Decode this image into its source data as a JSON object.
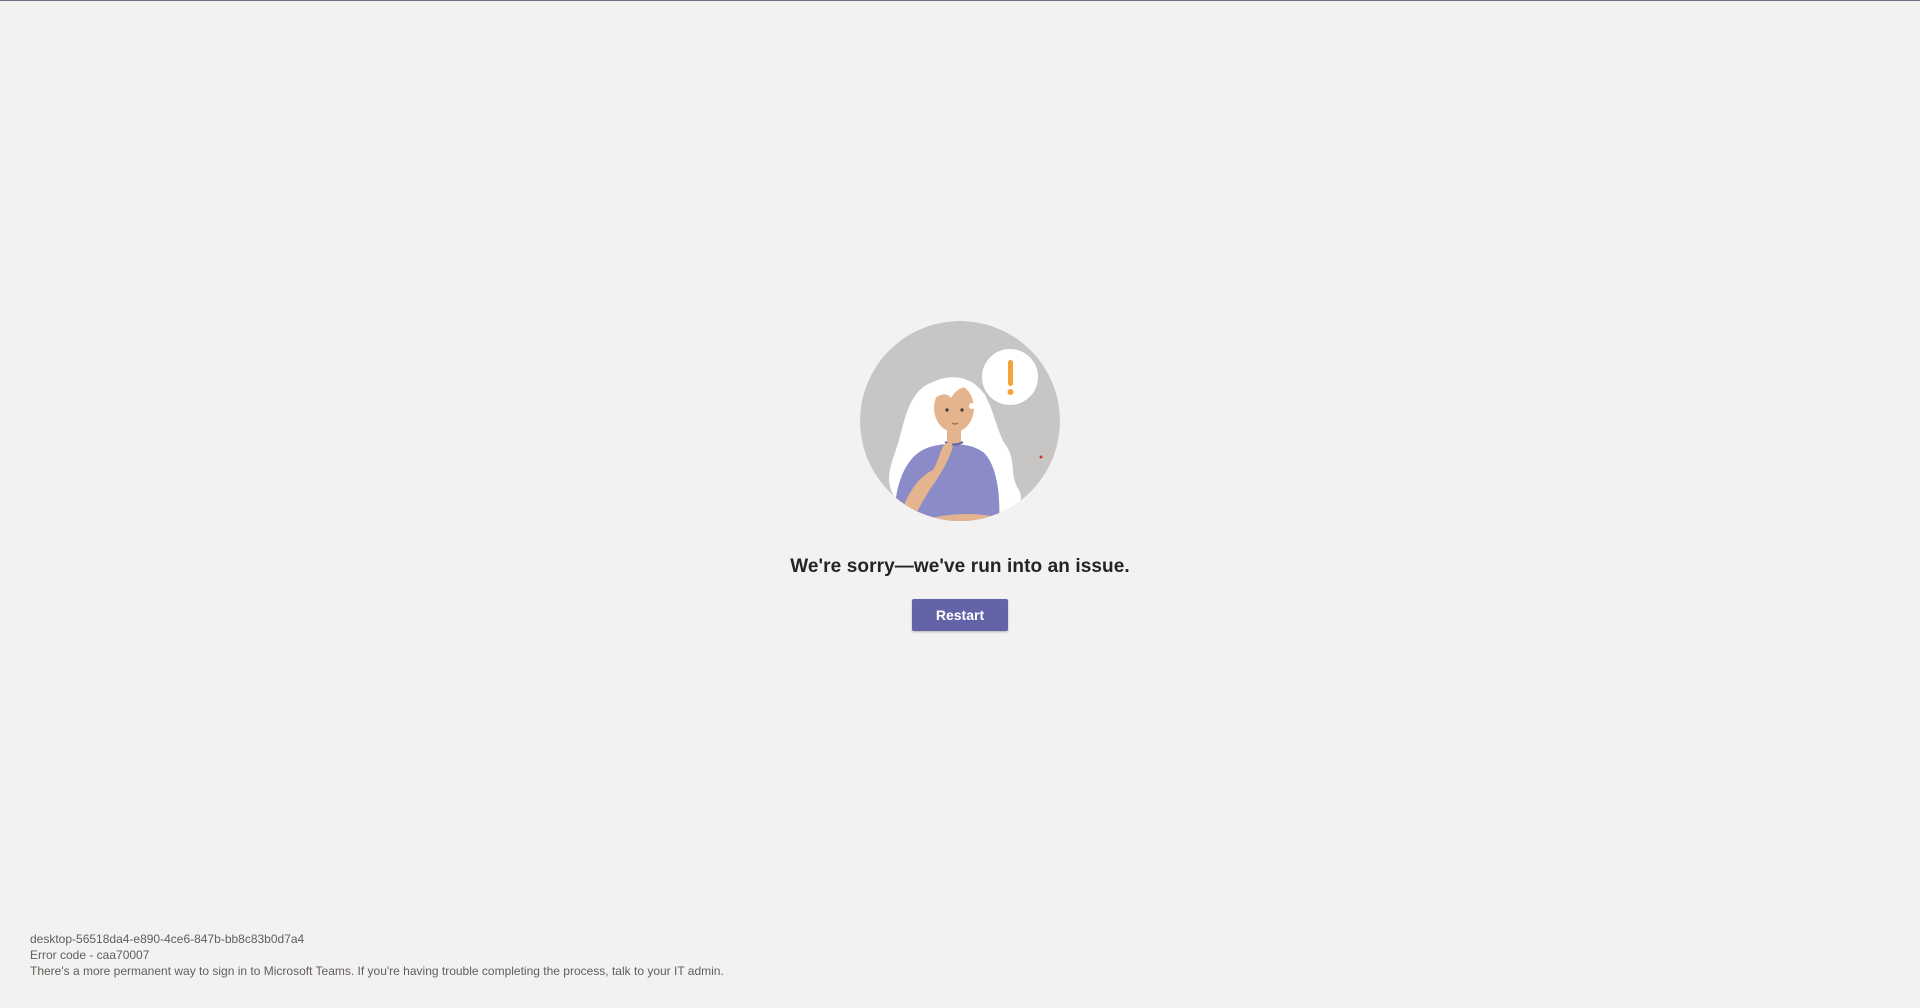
{
  "error_page": {
    "headline": "We're sorry—we've run into an issue.",
    "restart_label": "Restart",
    "illustration": "person-thinking-with-exclamation-illustration",
    "accent_color": "#6264a7"
  },
  "footer": {
    "session_id": "desktop-56518da4-e890-4ce6-847b-bb8c83b0d7a4",
    "error_code": "Error code - caa70007",
    "help_text": "There's a more permanent way to sign in to Microsoft Teams. If you're having trouble completing the process, talk to your IT admin."
  }
}
